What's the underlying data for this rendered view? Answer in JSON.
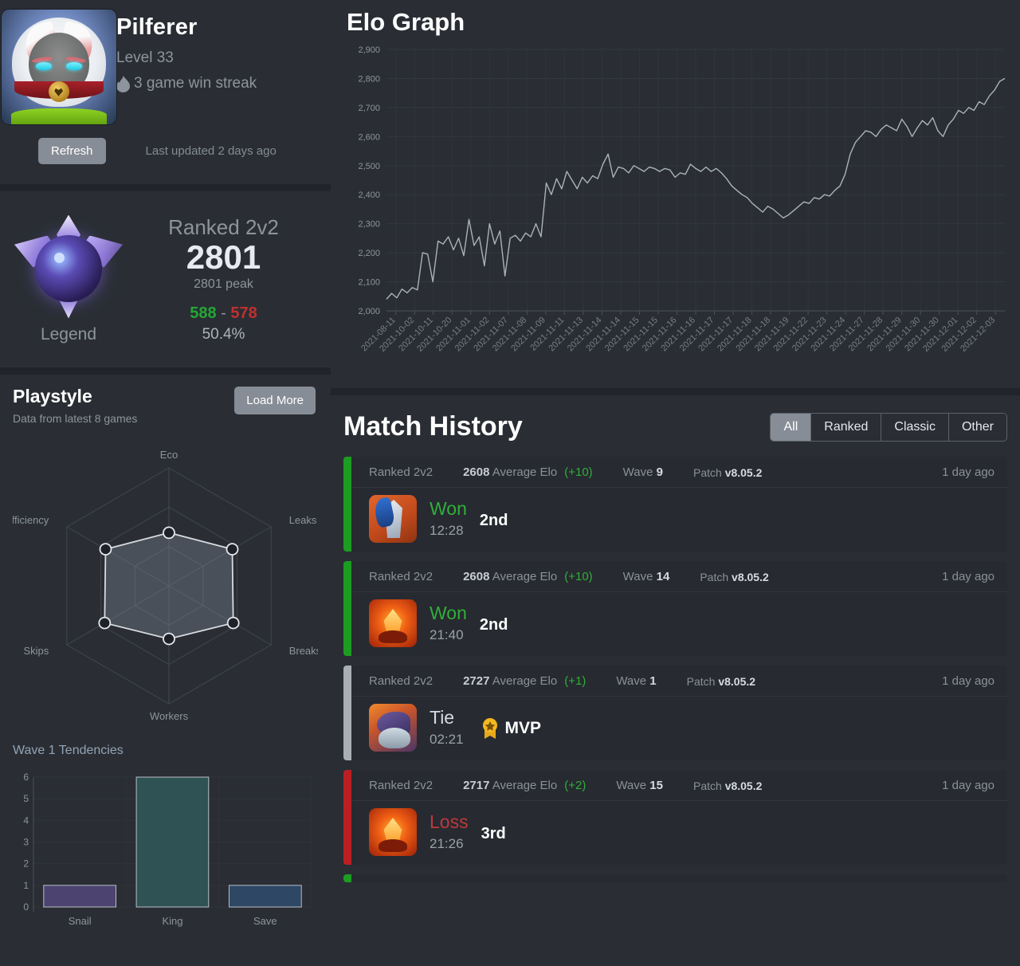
{
  "profile": {
    "name": "Pilferer",
    "level": "Level 33",
    "streak": "3 game win streak",
    "streak_icon": "flame-icon",
    "refresh_label": "Refresh",
    "last_updated": "Last updated 2 days ago",
    "avatar_icon": "cat-avatar"
  },
  "rank": {
    "mode": "Ranked 2v2",
    "elo": "2801",
    "peak": "2801 peak",
    "wins": "588",
    "separator": "-",
    "losses": "578",
    "winrate": "50.4%",
    "tier_name": "Legend",
    "badge_icon": "legend-rank-icon",
    "win_color": "#23a833",
    "loss_color": "#c03030"
  },
  "playstyle": {
    "title": "Playstyle",
    "subtitle": "Data from latest 8 games",
    "load_more_label": "Load More",
    "bars_title": "Wave 1 Tendencies"
  },
  "elo_panel": {
    "title": "Elo Graph"
  },
  "match_history": {
    "title": "Match History",
    "tabs": [
      {
        "label": "All",
        "active": true
      },
      {
        "label": "Ranked",
        "active": false
      },
      {
        "label": "Classic",
        "active": false
      },
      {
        "label": "Other",
        "active": false
      }
    ],
    "matches": [
      {
        "mode": "Ranked 2v2",
        "avg_elo_value": "2608",
        "avg_elo_label": "Average Elo",
        "delta": "(+10)",
        "wave_label": "Wave",
        "wave_value": "9",
        "patch_label": "Patch",
        "patch_value": "v8.05.2",
        "ago": "1 day ago",
        "result": "Won",
        "result_type": "win",
        "duration": "12:28",
        "placement": "2nd",
        "mvp": false,
        "hero_icon": "knight-hero-icon"
      },
      {
        "mode": "Ranked 2v2",
        "avg_elo_value": "2608",
        "avg_elo_label": "Average Elo",
        "delta": "(+10)",
        "wave_label": "Wave",
        "wave_value": "14",
        "patch_label": "Patch",
        "patch_value": "v8.05.2",
        "ago": "1 day ago",
        "result": "Won",
        "result_type": "win",
        "duration": "21:40",
        "placement": "2nd",
        "mvp": false,
        "hero_icon": "fire-hero-icon"
      },
      {
        "mode": "Ranked 2v2",
        "avg_elo_value": "2727",
        "avg_elo_label": "Average Elo",
        "delta": "(+1)",
        "wave_label": "Wave",
        "wave_value": "1",
        "patch_label": "Patch",
        "patch_value": "v8.05.2",
        "ago": "1 day ago",
        "result": "Tie",
        "result_type": "tie",
        "duration": "02:21",
        "placement": "",
        "mvp": true,
        "mvp_label": "MVP",
        "hero_icon": "serpent-hero-icon"
      },
      {
        "mode": "Ranked 2v2",
        "avg_elo_value": "2717",
        "avg_elo_label": "Average Elo",
        "delta": "(+2)",
        "wave_label": "Wave",
        "wave_value": "15",
        "patch_label": "Patch",
        "patch_value": "v8.05.2",
        "ago": "1 day ago",
        "result": "Loss",
        "result_type": "loss",
        "duration": "21:26",
        "placement": "3rd",
        "mvp": false,
        "hero_icon": "fire-hero-icon"
      }
    ]
  },
  "chart_data": [
    {
      "type": "line",
      "title": "Elo Graph",
      "xlabel": "",
      "ylabel": "",
      "ylim": [
        2000,
        2900
      ],
      "yticks": [
        "2,000",
        "2,100",
        "2,200",
        "2,300",
        "2,400",
        "2,500",
        "2,600",
        "2,700",
        "2,800",
        "2,900"
      ],
      "grid": true,
      "legend": "none",
      "line_color": "#aab2bb",
      "xticks": [
        "2021-08-11",
        "2021-10-02",
        "2021-10-11",
        "2021-10-20",
        "2021-11-01",
        "2021-11-02",
        "2021-11-07",
        "2021-11-08",
        "2021-11-09",
        "2021-11-11",
        "2021-11-13",
        "2021-11-14",
        "2021-11-14",
        "2021-11-15",
        "2021-11-15",
        "2021-11-16",
        "2021-11-16",
        "2021-11-17",
        "2021-11-17",
        "2021-11-18",
        "2021-11-18",
        "2021-11-19",
        "2021-11-22",
        "2021-11-23",
        "2021-11-24",
        "2021-11-27",
        "2021-11-28",
        "2021-11-29",
        "2021-11-30",
        "2021-11-30",
        "2021-12-01",
        "2021-12-02",
        "2021-12-03"
      ],
      "values": [
        2040,
        2060,
        2045,
        2075,
        2062,
        2080,
        2072,
        2200,
        2195,
        2100,
        2240,
        2230,
        2255,
        2210,
        2250,
        2190,
        2315,
        2225,
        2255,
        2155,
        2300,
        2230,
        2275,
        2120,
        2250,
        2260,
        2240,
        2268,
        2255,
        2300,
        2255,
        2440,
        2400,
        2455,
        2420,
        2480,
        2450,
        2420,
        2460,
        2440,
        2465,
        2455,
        2505,
        2540,
        2460,
        2495,
        2490,
        2475,
        2500,
        2490,
        2480,
        2495,
        2490,
        2480,
        2490,
        2485,
        2460,
        2475,
        2470,
        2505,
        2490,
        2480,
        2495,
        2480,
        2490,
        2475,
        2455,
        2430,
        2415,
        2400,
        2390,
        2370,
        2355,
        2340,
        2360,
        2350,
        2335,
        2320,
        2330,
        2345,
        2360,
        2375,
        2370,
        2390,
        2385,
        2400,
        2395,
        2415,
        2430,
        2470,
        2540,
        2580,
        2600,
        2620,
        2615,
        2600,
        2625,
        2640,
        2630,
        2620,
        2660,
        2635,
        2600,
        2630,
        2655,
        2640,
        2665,
        2620,
        2600,
        2640,
        2660,
        2690,
        2680,
        2700,
        2690,
        2720,
        2710,
        2740,
        2760,
        2790,
        2800
      ],
      "last_value": 2801
    },
    {
      "type": "radar",
      "title": "Playstyle",
      "categories": [
        "Eco",
        "Leaks",
        "Breaks",
        "Workers",
        "Skips",
        "Efficiency"
      ],
      "values": [
        0.45,
        0.62,
        0.63,
        0.45,
        0.63,
        0.62
      ],
      "rings": 3,
      "max": 1.0,
      "fill_color": "#7b8490",
      "line_color": "#d7dbe0"
    },
    {
      "type": "bar",
      "title": "Wave 1 Tendencies",
      "categories": [
        "Snail",
        "King",
        "Save"
      ],
      "values": [
        1,
        6,
        1
      ],
      "colors": [
        "#4d4370",
        "#2f5355",
        "#2e4765"
      ],
      "ylim": [
        0,
        6
      ],
      "yticks": [
        "0",
        "1",
        "2",
        "3",
        "4",
        "5",
        "6"
      ],
      "grid": true
    }
  ]
}
